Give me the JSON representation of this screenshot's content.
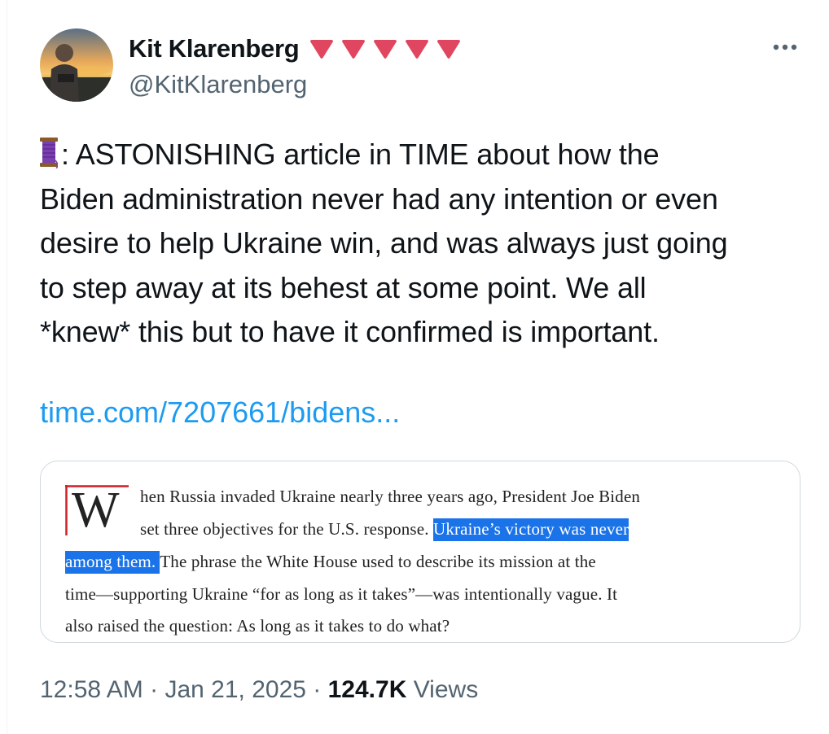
{
  "author": {
    "display_name": "Kit Klarenberg",
    "handle": "@KitKlarenberg",
    "name_emoji": "heart-suit-icons",
    "name_emoji_count": 5,
    "name_emoji_color": "#e0465f"
  },
  "more_icon": "more-horizontal-icon",
  "tweet": {
    "text_lines": [
      ": ASTONISHING article in TIME about how the",
      "Biden administration never had any intention or even",
      "desire to help Ukraine win, and was always just going",
      "to step away at its behest at some point. We all",
      "*knew* this but to have it confirmed is important."
    ],
    "leading_emoji": "thread-spool-icon",
    "link_text": "time.com/7207661/bidens..."
  },
  "excerpt": {
    "dropcap": "W",
    "line1": "hen Russia invaded Ukraine nearly three years ago, President Joe Biden",
    "line2_plain": "set three objectives for the U.S. response. ",
    "line2_highlight": "Ukraine’s victory was never",
    "line3_highlight": "among them. ",
    "line3_plain": "The phrase the White House used to describe its mission at the",
    "line4": "time—supporting Ukraine “for as long as it takes”—was intentionally vague. It",
    "line5": "also raised the question: As long as it takes to do what?",
    "highlight_color": "#1a73e8",
    "dropcap_rule_color": "#cc2127"
  },
  "meta": {
    "time": "12:58 AM",
    "separator": "·",
    "date": "Jan 21, 2025",
    "views_count": "124.7K",
    "views_label": "Views"
  },
  "colors": {
    "link": "#1d9bf0",
    "secondary_text": "#536471",
    "border": "#cfd9de"
  }
}
